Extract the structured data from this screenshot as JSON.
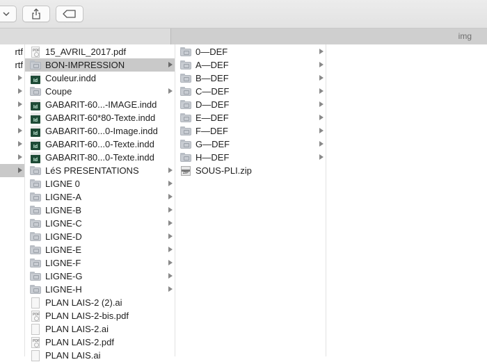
{
  "window": {
    "path_title": "img",
    "toolbar": {
      "view_button_icon": "chevron-down-icon",
      "share_button_icon": "share-icon",
      "tags_button_icon": "tag-icon"
    }
  },
  "column0": {
    "items": [
      {
        "label": "rtf",
        "icon": "none",
        "has_children": false,
        "selected": false
      },
      {
        "label": "rtf",
        "icon": "none",
        "has_children": false,
        "selected": false
      },
      {
        "label": "",
        "icon": "none",
        "has_children": true,
        "selected": false
      },
      {
        "label": "",
        "icon": "none",
        "has_children": true,
        "selected": false
      },
      {
        "label": "",
        "icon": "none",
        "has_children": true,
        "selected": false
      },
      {
        "label": "",
        "icon": "none",
        "has_children": true,
        "selected": false
      },
      {
        "label": "",
        "icon": "none",
        "has_children": true,
        "selected": false
      },
      {
        "label": "",
        "icon": "none",
        "has_children": true,
        "selected": false
      },
      {
        "label": "",
        "icon": "none",
        "has_children": true,
        "selected": false
      },
      {
        "label": "",
        "icon": "none",
        "has_children": true,
        "selected": true
      }
    ]
  },
  "column1": {
    "items": [
      {
        "label": "15_AVRIL_2017.pdf",
        "icon": "pdf",
        "has_children": false,
        "selected": false
      },
      {
        "label": "BON-IMPRESSION",
        "icon": "folder",
        "has_children": true,
        "selected": true
      },
      {
        "label": "Couleur.indd",
        "icon": "indd",
        "has_children": false,
        "selected": false
      },
      {
        "label": "Coupe",
        "icon": "folder",
        "has_children": true,
        "selected": false
      },
      {
        "label": "GABARIT-60...-IMAGE.indd",
        "icon": "indd",
        "has_children": false,
        "selected": false
      },
      {
        "label": "GABARIT-60*80-Texte.indd",
        "icon": "indd",
        "has_children": false,
        "selected": false
      },
      {
        "label": "GABARIT-60...0-Image.indd",
        "icon": "indd",
        "has_children": false,
        "selected": false
      },
      {
        "label": "GABARIT-60...0-Texte.indd",
        "icon": "indd",
        "has_children": false,
        "selected": false
      },
      {
        "label": "GABARIT-80...0-Texte.indd",
        "icon": "indd",
        "has_children": false,
        "selected": false
      },
      {
        "label": "LéS PRESENTATIONS",
        "icon": "folder",
        "has_children": true,
        "selected": false
      },
      {
        "label": "LIGNE 0",
        "icon": "folder",
        "has_children": true,
        "selected": false
      },
      {
        "label": "LIGNE-A",
        "icon": "folder",
        "has_children": true,
        "selected": false
      },
      {
        "label": "LIGNE-B",
        "icon": "folder",
        "has_children": true,
        "selected": false
      },
      {
        "label": "LIGNE-C",
        "icon": "folder",
        "has_children": true,
        "selected": false
      },
      {
        "label": "LIGNE-D",
        "icon": "folder",
        "has_children": true,
        "selected": false
      },
      {
        "label": "LIGNE-E",
        "icon": "folder",
        "has_children": true,
        "selected": false
      },
      {
        "label": "LIGNE-F",
        "icon": "folder",
        "has_children": true,
        "selected": false
      },
      {
        "label": "LIGNE-G",
        "icon": "folder",
        "has_children": true,
        "selected": false
      },
      {
        "label": "LIGNE-H",
        "icon": "folder",
        "has_children": true,
        "selected": false
      },
      {
        "label": "PLAN LAIS-2 (2).ai",
        "icon": "doc",
        "has_children": false,
        "selected": false
      },
      {
        "label": "PLAN LAIS-2-bis.pdf",
        "icon": "pdf",
        "has_children": false,
        "selected": false
      },
      {
        "label": "PLAN LAIS-2.ai",
        "icon": "doc",
        "has_children": false,
        "selected": false
      },
      {
        "label": "PLAN LAIS-2.pdf",
        "icon": "pdf",
        "has_children": false,
        "selected": false
      },
      {
        "label": "PLAN LAIS.ai",
        "icon": "doc",
        "has_children": false,
        "selected": false
      }
    ]
  },
  "column2": {
    "items": [
      {
        "label": "0—DEF",
        "icon": "folder",
        "has_children": true
      },
      {
        "label": "A—DEF",
        "icon": "folder",
        "has_children": true
      },
      {
        "label": "B—DEF",
        "icon": "folder",
        "has_children": true
      },
      {
        "label": "C—DEF",
        "icon": "folder",
        "has_children": true
      },
      {
        "label": "D—DEF",
        "icon": "folder",
        "has_children": true
      },
      {
        "label": "E—DEF",
        "icon": "folder",
        "has_children": true
      },
      {
        "label": "F—DEF",
        "icon": "folder",
        "has_children": true
      },
      {
        "label": "G—DEF",
        "icon": "folder",
        "has_children": true
      },
      {
        "label": "H—DEF",
        "icon": "folder",
        "has_children": true
      },
      {
        "label": "SOUS-PLI.zip",
        "icon": "zip",
        "has_children": false
      }
    ]
  },
  "icon_labels": {
    "indd": "Id",
    "pdf": "PDF",
    "zip": "ZIP"
  }
}
